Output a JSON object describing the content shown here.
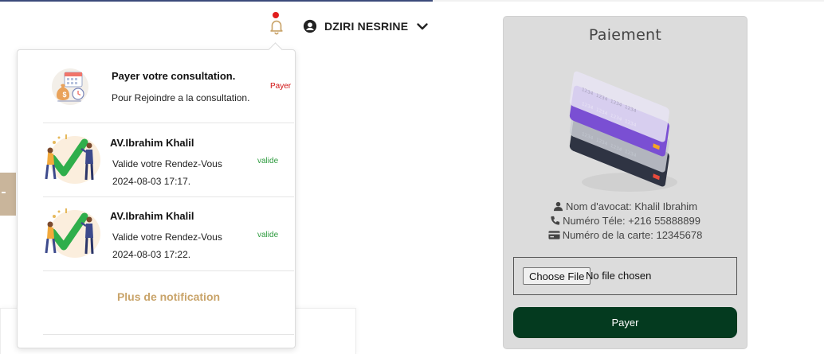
{
  "header": {
    "user_name": "DZIRI NESRINE",
    "notification_dot_color": "#e11d1d",
    "bell_color": "#c9a46a",
    "icons": {
      "bell": "bell-icon",
      "user": "user-circle-icon",
      "dropdown": "chevron-down-icon"
    }
  },
  "notifications": {
    "items": [
      {
        "title": "Payer votre consultation.",
        "desc": "Pour Rejoindre a la consultation.",
        "tag": "Payer",
        "tag_color": "#d01010",
        "icon": "money-bag-calendar-icon"
      },
      {
        "title": "AV.Ibrahim Khalil",
        "desc": "Valide votre Rendez-Vous",
        "date": "2024-08-03 17:17.",
        "tag": "valide",
        "tag_color": "#2e9b3f",
        "icon": "checkmark-people-illustration"
      },
      {
        "title": "AV.Ibrahim Khalil",
        "desc": "Valide votre Rendez-Vous",
        "date": "2024-08-03 17:22.",
        "tag": "valide",
        "tag_color": "#2e9b3f",
        "icon": "checkmark-people-illustration"
      }
    ],
    "more_label": "Plus de notification",
    "more_color": "#c9a46a"
  },
  "payment": {
    "title": "Paiement",
    "illustration": "credit-cards-stack-illustration",
    "lawyer": "Nom d'avocat: Khalil Ibrahim",
    "phone": "Numéro Téle: +216 55888899",
    "card": "Numéro de la carte: 12345678",
    "file_button": "Choose File",
    "file_status": "No file chosen",
    "pay_button": "Payer",
    "pay_button_color": "#043a1f"
  }
}
